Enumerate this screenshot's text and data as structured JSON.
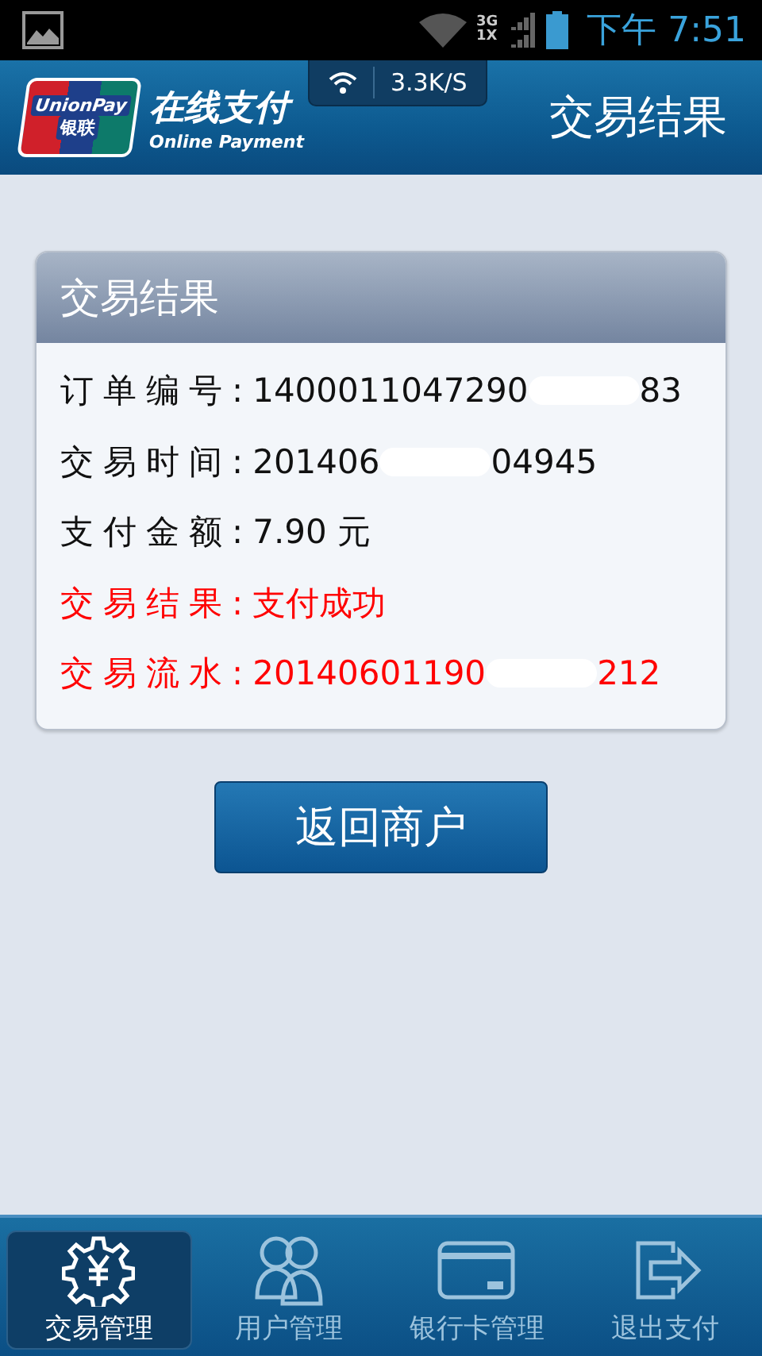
{
  "status_bar": {
    "network_top": "3G",
    "network_bottom": "1X",
    "time": "下午 7:51"
  },
  "header": {
    "logo_text": "UnionPay",
    "logo_subtext": "银联",
    "brand_title": "在线支付",
    "brand_subtitle": "Online Payment",
    "speed": "3.3K/S",
    "title": "交易结果"
  },
  "card": {
    "title": "交易结果",
    "rows": [
      {
        "label": "订单编号:",
        "value_parts": [
          "1400011047290",
          "83"
        ],
        "highlight": false
      },
      {
        "label": "交易时间:",
        "value_parts": [
          "201406",
          "04945"
        ],
        "highlight": false
      },
      {
        "label": "支付金额:",
        "value_parts": [
          "7.90 元"
        ],
        "highlight": false
      },
      {
        "label": "交易结果:",
        "value_parts": [
          "支付成功"
        ],
        "highlight": true
      },
      {
        "label": "交易流水:",
        "value_parts": [
          "20140601190",
          "212"
        ],
        "highlight": true
      }
    ]
  },
  "button": "返回商户",
  "tabs": [
    {
      "label": "交易管理",
      "kind": "gear",
      "selected": true
    },
    {
      "label": "用户管理",
      "kind": "users",
      "selected": false
    },
    {
      "label": "银行卡管理",
      "kind": "card",
      "selected": false
    },
    {
      "label": "退出支付",
      "kind": "exit",
      "selected": false
    }
  ]
}
